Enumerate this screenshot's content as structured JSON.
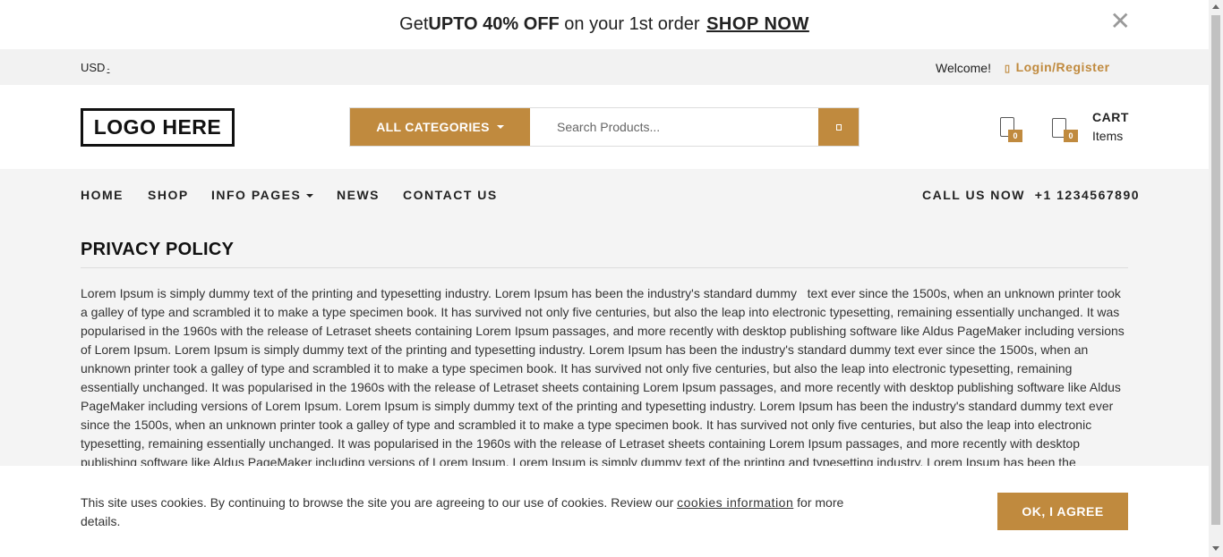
{
  "promo": {
    "prefix": "Get ",
    "highlight": "UPTO 40% OFF",
    "middle": " on your 1st order ",
    "link": "SHOP NOW",
    "close_icon": "close-icon"
  },
  "topbar": {
    "currency": "USD",
    "currency_caret": "-",
    "welcome": "Welcome!",
    "login_icon": "user-icon",
    "login_glyph": "▯",
    "login": "Login/Register"
  },
  "header": {
    "logo": "LOGO HERE",
    "category_label": "ALL CATEGORIES",
    "search_placeholder": "Search Products...",
    "search_icon": "search-icon",
    "wishlist_count": "0",
    "compare_count": "0",
    "cart_label": "CART",
    "cart_items": "Items"
  },
  "nav": {
    "items": [
      "HOME",
      "SHOP",
      "INFO PAGES",
      "NEWS",
      "CONTACT US"
    ],
    "call_label": "CALL US NOW",
    "phone": "+1 1234567890"
  },
  "main": {
    "title": "PRIVACY POLICY",
    "body": "Lorem Ipsum is simply dummy text of the printing and typesetting industry. Lorem Ipsum has been the industry's standard dummy   text ever since the 1500s, when an unknown printer took a galley of type and scrambled it to make a type specimen book. It has survived not only five centuries, but also the leap into electronic typesetting, remaining essentially unchanged. It was popularised in the 1960s with the release of Letraset sheets containing Lorem Ipsum passages, and more recently with desktop publishing software like Aldus PageMaker including versions of Lorem Ipsum. Lorem Ipsum is simply dummy text of the printing and typesetting industry. Lorem Ipsum has been the industry's standard dummy text ever since the 1500s, when an unknown printer took a galley of type and scrambled it to make a type specimen book. It has survived not only five centuries, but also the leap into electronic typesetting, remaining essentially unchanged. It was popularised in the 1960s with the release of Letraset sheets containing Lorem Ipsum passages, and more recently with desktop publishing software like Aldus PageMaker including versions of Lorem Ipsum. Lorem Ipsum is simply dummy text of the printing and typesetting industry. Lorem Ipsum has been the industry's standard dummy text ever since the 1500s, when an unknown printer took a galley of type and scrambled it to make a type specimen book. It has survived not only five centuries, but also the leap into electronic typesetting, remaining essentially unchanged. It was popularised in the 1960s with the release of Letraset sheets containing Lorem Ipsum passages, and more recently with desktop publishing software like Aldus PageMaker including versions of Lorem Ipsum. Lorem Ipsum is simply dummy text of the printing and typesetting industry. Lorem Ipsum has been the"
  },
  "cookie": {
    "text_before": "This site uses cookies. By continuing to browse the site you are agreeing to our use of cookies. Review our ",
    "link": "cookies information",
    "text_after": " for more details.",
    "button": "OK, I AGREE"
  },
  "colors": {
    "accent": "#c08a3e",
    "page_bg": "#f4f4f4",
    "text": "#222222"
  }
}
